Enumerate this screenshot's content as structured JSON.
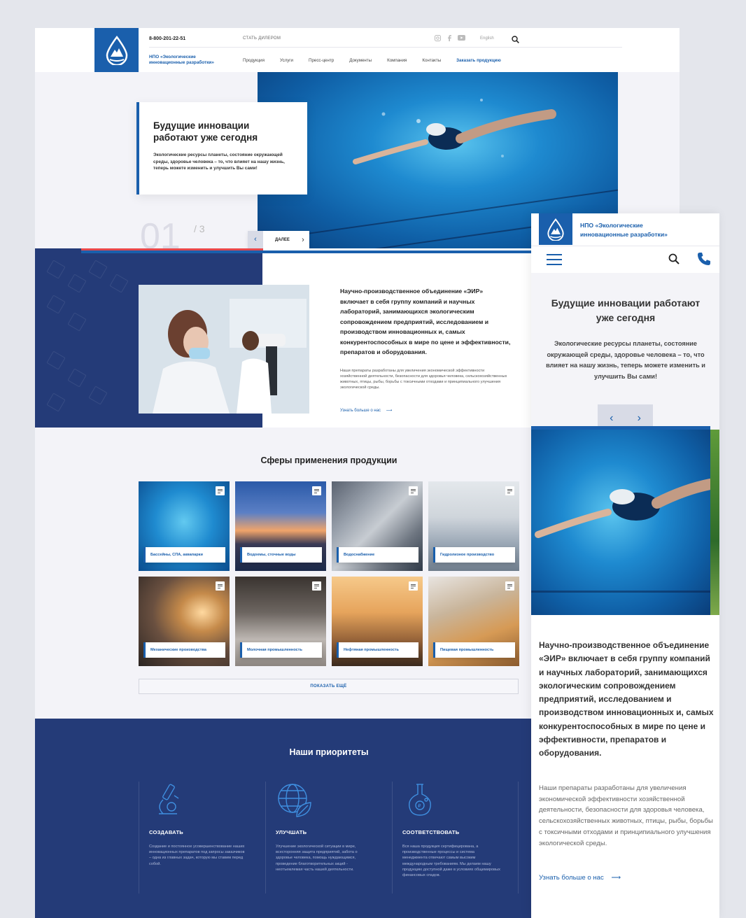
{
  "desktop": {
    "header": {
      "phone": "8-800-201-22-51",
      "dealer_link": "СТАТЬ ДИЛЕРОМ",
      "language": "English",
      "company_line1": "НПО «Экологические",
      "company_line2": "инновационные разработки»",
      "nav": [
        "Продукция",
        "Услуги",
        "Пресс-центр",
        "Документы",
        "Компания",
        "Контакты"
      ],
      "order_link": "Заказать продукцию"
    },
    "hero": {
      "title": "Будущие инновации работают уже сегодня",
      "text": "Экологические ресурсы планеты, состояние окружающей среды, здоровье человека – то, что влияет на нашу жизнь, теперь можете изменить и улучшить Вы сами!",
      "slide_number": "01",
      "slide_total": "/ 3",
      "next_label": "ДАЛЕЕ"
    },
    "about": {
      "title": "Научно-производственное объединение «ЭИР» включает в себя группу компаний и научных лабораторий, занимающихся экологическим сопровождением предприятий, исследованием и производством инновационных и, самых конкурентоспособных в мире по цене и эффективности, препаратов и оборудования.",
      "text": "Наши препараты разработаны для увеличения экономической эффективности хозяйственной деятельности, безопасности для здоровья человека, сельскохозяйственных животных, птицы, рыбы, борьбы с токсичными отходами и принципиального улучшения экологической среды.",
      "link": "Узнать больше о нас"
    },
    "spheres": {
      "title": "Сферы применения продукции",
      "items": [
        {
          "label": "Бассейны, СПА, аквапарки"
        },
        {
          "label": "Водоемы, сточные воды"
        },
        {
          "label": "Водоснабжение"
        },
        {
          "label": "Гидролизное производство"
        },
        {
          "label": "Механические производства"
        },
        {
          "label": "Молочная промышленность"
        },
        {
          "label": "Нефтяная промышленность"
        },
        {
          "label": "Пищевая промышленность"
        }
      ],
      "show_more": "ПОКАЗАТЬ ЕЩЁ"
    },
    "priorities": {
      "title": "Наши приоритеты",
      "items": [
        {
          "heading": "СОЗДАВАТЬ",
          "icon": "microscope-icon",
          "text": "Создание и постоянное усовершенствование наших инновационных препаратов под запросы заказчиков – одна из главных задач, которую мы ставим перед собой."
        },
        {
          "heading": "УЛУЧШАТЬ",
          "icon": "globe-leaf-icon",
          "text": "Улучшение экологической ситуации в мире, всесторонняя защита предприятий, забота о здоровье человека, помощь нуждающимся, проведение благотворительных акций - неотъемлемая часть нашей деятельности."
        },
        {
          "heading": "СООТВЕТСТВОВАТЬ",
          "icon": "flask-icon",
          "text": "Вся наша продукция сертифицирована, а производственные процессы и система менеджмента отвечают самым высоким международным требованиям. Мы делаем нашу продукцию доступной даже в условиях общемировых финансовых спадов."
        }
      ]
    }
  },
  "mobile": {
    "company_line1": "НПО «Экологические",
    "company_line2": "инновационные разработки»",
    "hero_title": "Будущие инновации работают уже сегодня",
    "hero_text": "Экологические ресурсы планеты, состояние окружающей среды, здоровье человека – то, что влияет на нашу жизнь, теперь можете изменить и улучшить Вы сами!",
    "about_title": "Научно-производственное объединение «ЭИР» включает в себя группу компаний и научных лабораторий, занимающихся экологическим сопровождением предприятий, исследованием и производством инновационных и, самых конкурентоспособных в мире по цене и эффективности, препаратов и оборудования.",
    "about_text": "Наши препараты разработаны для увеличения экономической эффективности хозяйственной деятельности, безопасности для здоровья человека, сельскохозяйственных животных, птицы, рыбы, борьбы с токсичными отходами и принципиального улучшения экологической среды.",
    "about_link": "Узнать больше о нас"
  },
  "colors": {
    "brand_blue": "#1a5fac",
    "navy": "#243b78",
    "accent_red": "#e8474a"
  }
}
